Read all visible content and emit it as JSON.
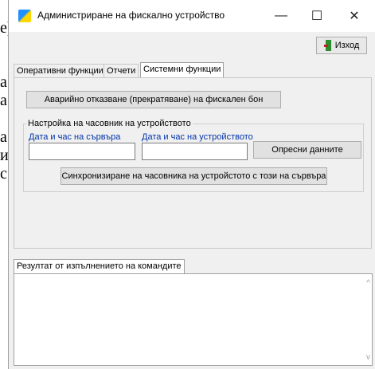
{
  "background_text": {
    "top": "e)",
    "lines": [
      "а",
      "а",
      "а",
      "и",
      "с"
    ]
  },
  "window": {
    "title": "Администриране на фискално устройство",
    "minimize": "—",
    "maximize": "☐",
    "close": "✕"
  },
  "toolbar": {
    "exit_label": "Изход"
  },
  "tabs": [
    {
      "label": "Оперативни функции"
    },
    {
      "label": "Отчети"
    },
    {
      "label": "Системни функции"
    }
  ],
  "system": {
    "emergency_cancel_label": "Аварийно отказване (прекратяване) на фискален бон",
    "clock_group_title": "Настройка на часовник на устройството",
    "server_datetime_label": "Дата и час на сървъра",
    "server_datetime_value": "",
    "device_datetime_label": "Дата и час на устройството",
    "device_datetime_value": "",
    "refresh_label": "Опресни данните",
    "sync_label": "Синхронизиране на часовника на устройстото с този на сървъра"
  },
  "result": {
    "tab_label": "Резултат от изпълнението на командите",
    "text": ""
  },
  "colors": {
    "app_icon": "#1e90ff",
    "exit_icon": "#2e8b2e",
    "label_blue": "#0033aa"
  }
}
